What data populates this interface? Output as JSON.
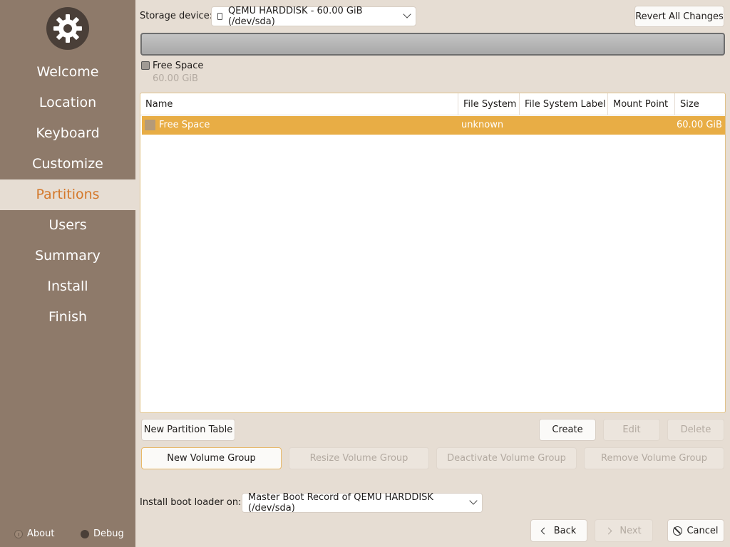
{
  "sidebar": {
    "items": [
      {
        "label": "Welcome"
      },
      {
        "label": "Location"
      },
      {
        "label": "Keyboard"
      },
      {
        "label": "Customize"
      },
      {
        "label": "Partitions"
      },
      {
        "label": "Users"
      },
      {
        "label": "Summary"
      },
      {
        "label": "Install"
      },
      {
        "label": "Finish"
      }
    ],
    "active_index": 4,
    "about_label": "About",
    "debug_label": "Debug"
  },
  "storage": {
    "label": "Storage device:",
    "value": "QEMU HARDDISK - 60.00 GiB (/dev/sda)",
    "revert_label": "Revert All Changes"
  },
  "legend": {
    "name": "Free Space",
    "size": "60.00 GiB"
  },
  "table": {
    "columns": [
      "Name",
      "File System",
      "File System Label",
      "Mount Point",
      "Size"
    ],
    "rows": [
      {
        "name": "Free Space",
        "fs": "unknown",
        "fs_label": "",
        "mount": "",
        "size": "60.00 GiB"
      }
    ]
  },
  "actions": {
    "new_partition_table": "New Partition Table",
    "create": "Create",
    "edit": "Edit",
    "delete": "Delete",
    "new_volume_group": "New Volume Group",
    "resize_volume_group": "Resize Volume Group",
    "deactivate_volume_group": "Deactivate Volume Group",
    "remove_volume_group": "Remove Volume Group"
  },
  "bootloader": {
    "label": "Install boot loader on:",
    "value": "Master Boot Record of QEMU HARDDISK (/dev/sda)"
  },
  "nav_buttons": {
    "back": "Back",
    "next": "Next",
    "cancel": "Cancel"
  },
  "colors": {
    "sidebar_bg": "#8e7a6a",
    "accent": "#d4782a",
    "selection": "#e8ad45",
    "window_bg": "#e6ddd3"
  }
}
